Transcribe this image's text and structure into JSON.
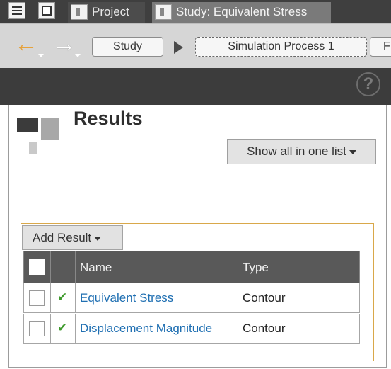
{
  "tabbar": {
    "icons": [
      "list-icon",
      "window-icon"
    ],
    "tabs": [
      {
        "label": "Project",
        "icon": "document-icon"
      },
      {
        "label": "Study: Equivalent Stress",
        "icon": "document-icon"
      }
    ]
  },
  "navbar": {
    "back_icon": "arrow-left-icon",
    "forward_icon": "arrow-right-icon",
    "breadcrumbs": [
      "Study",
      "Simulation Process 1",
      "F"
    ]
  },
  "help": {
    "glyph": "?"
  },
  "panel": {
    "title": "Results",
    "show_all_button": "Show all in one list",
    "add_result_button": "Add Result",
    "table": {
      "headers": {
        "name": "Name",
        "type": "Type"
      },
      "rows": [
        {
          "name": "Equivalent Stress",
          "type": "Contour",
          "status_icon": "checkmark-icon"
        },
        {
          "name": "Displacement Magnitude",
          "type": "Contour",
          "status_icon": "checkmark-icon"
        }
      ]
    }
  },
  "colors": {
    "accent_orange": "#e6a23c",
    "link_blue": "#1f6fb2",
    "check_green": "#3f9a2d",
    "header_dark": "#595959"
  }
}
